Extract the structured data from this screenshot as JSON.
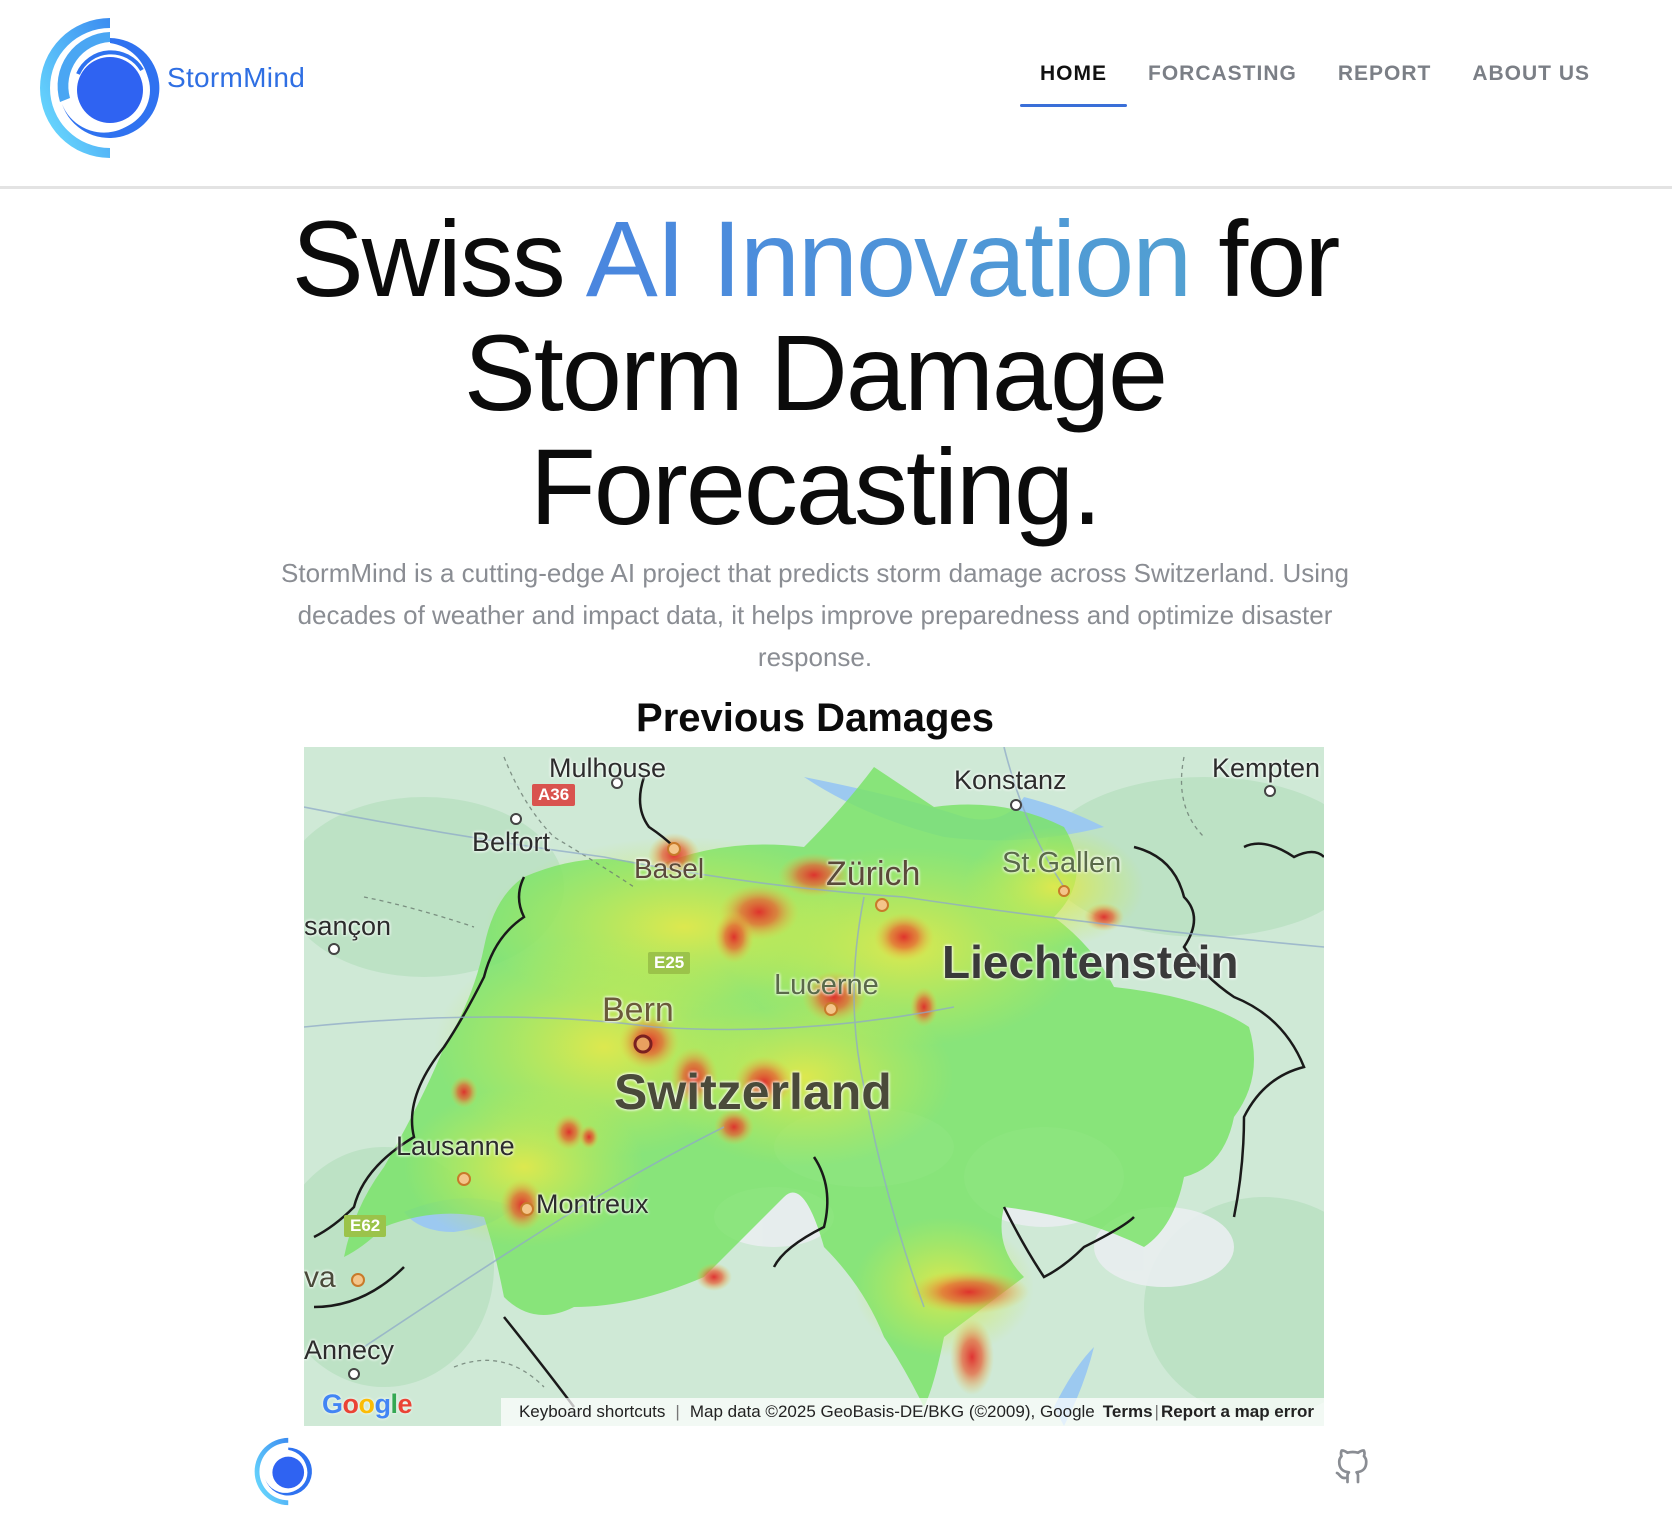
{
  "app": {
    "brand": "StormMind"
  },
  "nav": {
    "items": [
      {
        "label": "HOME",
        "active": true
      },
      {
        "label": "FORCASTING",
        "active": false
      },
      {
        "label": "REPORT",
        "active": false
      },
      {
        "label": "ABOUT US",
        "active": false
      }
    ]
  },
  "hero": {
    "title_part1": "Swiss",
    "title_accent": "AI Innovation",
    "title_part2": "for",
    "title_line2": "Storm Damage",
    "title_line3": "Forecasting.",
    "subtitle": "StormMind is a cutting-edge AI project that predicts storm damage across Switzerland. Using decades of weather and impact data, it helps improve preparedness and optimize disaster response."
  },
  "map_section": {
    "title": "Previous Damages",
    "labels": {
      "mulhouse": "Mulhouse",
      "konstanz": "Konstanz",
      "kempten": "Kempten",
      "belfort": "Belfort",
      "basel": "Basel",
      "zurich": "Zürich",
      "st_gallen": "St.Gallen",
      "besancon": "sançon",
      "liechtenstein": "Liechtenstein",
      "lucerne": "Lucerne",
      "bern": "Bern",
      "switzerland": "Switzerland",
      "lausanne": "Lausanne",
      "montreux": "Montreux",
      "geneva": "va",
      "annecy": "Annecy"
    },
    "roads": {
      "a36": "A36",
      "e25": "E25",
      "e62": "E62"
    },
    "attribution": {
      "google": "Google",
      "keyboard_shortcuts": "Keyboard shortcuts",
      "map_data": "Map data ©2025 GeoBasis-DE/BKG (©2009), Google",
      "terms": "Terms",
      "report_error": "Report a map error"
    }
  },
  "colors": {
    "accent": "#3a6fd8",
    "brand_text": "#2f6fe3",
    "heat_low": "#7be36a",
    "heat_mid": "#e6e84a",
    "heat_high": "#e23b3b"
  },
  "icons": {
    "footer_link": "github-icon"
  }
}
